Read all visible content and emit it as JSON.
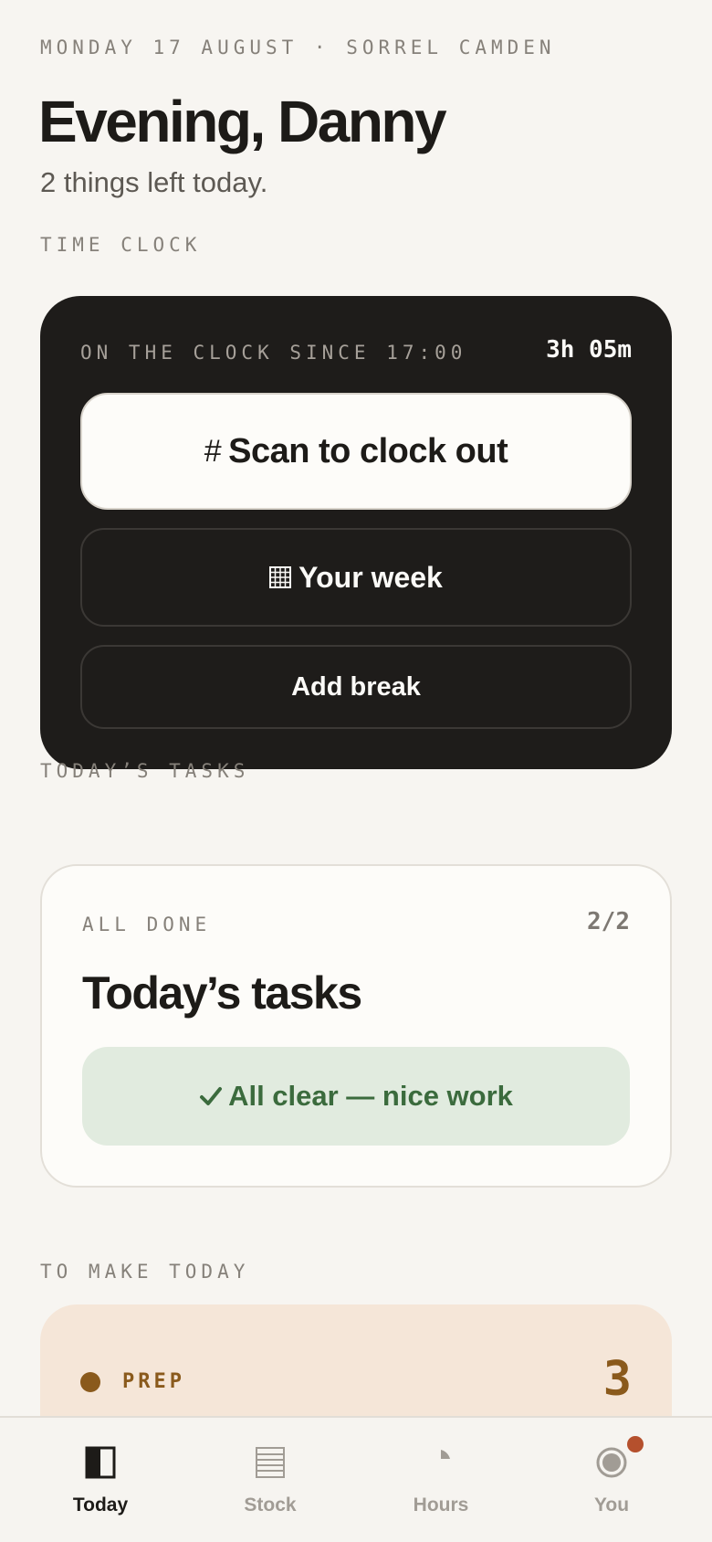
{
  "header": {
    "dateline": "MONDAY 17 AUGUST · SORREL CAMDEN",
    "greeting": "Evening, Danny",
    "subtitle": "2 things left today."
  },
  "time_clock": {
    "section_label": "TIME CLOCK",
    "status": "ON THE CLOCK SINCE 17:00",
    "elapsed": "3h 05m",
    "scan_icon": "#",
    "scan_label": "Scan to clock out",
    "week_label": "Your week",
    "break_label": "Add break"
  },
  "tasks": {
    "section_label": "TODAY’S TASKS",
    "status": "ALL DONE",
    "count": "2/2",
    "title": "Today’s tasks",
    "all_clear": "All clear — nice work"
  },
  "to_make": {
    "section_label": "TO MAKE TODAY",
    "category": "PREP",
    "count": "3"
  },
  "nav": {
    "items": [
      {
        "label": "Today",
        "icon": "today-icon",
        "active": true
      },
      {
        "label": "Stock",
        "icon": "stock-icon",
        "active": false
      },
      {
        "label": "Hours",
        "icon": "hours-icon",
        "active": false
      },
      {
        "label": "You",
        "icon": "profile-icon",
        "active": false,
        "notification": true
      }
    ]
  },
  "colors": {
    "background": "#f7f5f1",
    "dark_card": "#1e1c1a",
    "success_bg": "#e1ebdf",
    "success_text": "#3b6b3d",
    "prep_bg": "#f5e6d8",
    "prep_accent": "#8a5a1c",
    "notification": "#b5502d"
  }
}
